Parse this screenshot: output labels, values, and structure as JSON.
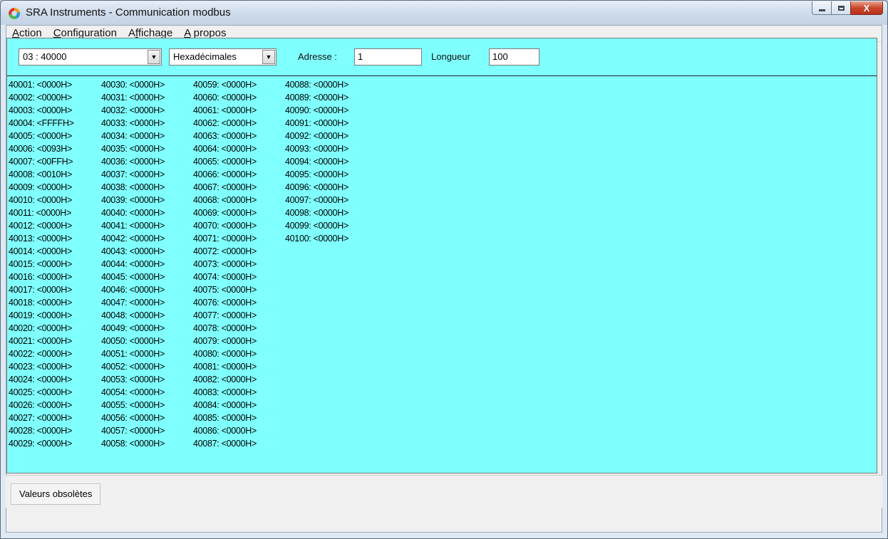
{
  "window": {
    "title": "SRA Instruments - Communication modbus",
    "close_symbol": "X"
  },
  "menu": [
    {
      "accel": "A",
      "rest": "ction"
    },
    {
      "accel": "C",
      "rest": "onfiguration"
    },
    {
      "prefix": "A",
      "accel": "f",
      "rest": "fichage"
    },
    {
      "accel": "A",
      "rest": " propos"
    }
  ],
  "toolbar": {
    "function_select": "03 : 40000",
    "format_select": "Hexadécimales",
    "address_label": "Adresse :",
    "address_value": "1",
    "length_label": "Longueur",
    "length_value": "100",
    "dropdown_arrow": "▼"
  },
  "registers": [
    "40001: <0000H>",
    "40002: <0000H>",
    "40003: <0000H>",
    "40004: <FFFFH>",
    "40005: <0000H>",
    "40006: <0093H>",
    "40007: <00FFH>",
    "40008: <0010H>",
    "40009: <0000H>",
    "40010: <0000H>",
    "40011: <0000H>",
    "40012: <0000H>",
    "40013: <0000H>",
    "40014: <0000H>",
    "40015: <0000H>",
    "40016: <0000H>",
    "40017: <0000H>",
    "40018: <0000H>",
    "40019: <0000H>",
    "40020: <0000H>",
    "40021: <0000H>",
    "40022: <0000H>",
    "40023: <0000H>",
    "40024: <0000H>",
    "40025: <0000H>",
    "40026: <0000H>",
    "40027: <0000H>",
    "40028: <0000H>",
    "40029: <0000H>",
    "40030: <0000H>",
    "40031: <0000H>",
    "40032: <0000H>",
    "40033: <0000H>",
    "40034: <0000H>",
    "40035: <0000H>",
    "40036: <0000H>",
    "40037: <0000H>",
    "40038: <0000H>",
    "40039: <0000H>",
    "40040: <0000H>",
    "40041: <0000H>",
    "40042: <0000H>",
    "40043: <0000H>",
    "40044: <0000H>",
    "40045: <0000H>",
    "40046: <0000H>",
    "40047: <0000H>",
    "40048: <0000H>",
    "40049: <0000H>",
    "40050: <0000H>",
    "40051: <0000H>",
    "40052: <0000H>",
    "40053: <0000H>",
    "40054: <0000H>",
    "40055: <0000H>",
    "40056: <0000H>",
    "40057: <0000H>",
    "40058: <0000H>",
    "40059: <0000H>",
    "40060: <0000H>",
    "40061: <0000H>",
    "40062: <0000H>",
    "40063: <0000H>",
    "40064: <0000H>",
    "40065: <0000H>",
    "40066: <0000H>",
    "40067: <0000H>",
    "40068: <0000H>",
    "40069: <0000H>",
    "40070: <0000H>",
    "40071: <0000H>",
    "40072: <0000H>",
    "40073: <0000H>",
    "40074: <0000H>",
    "40075: <0000H>",
    "40076: <0000H>",
    "40077: <0000H>",
    "40078: <0000H>",
    "40079: <0000H>",
    "40080: <0000H>",
    "40081: <0000H>",
    "40082: <0000H>",
    "40083: <0000H>",
    "40084: <0000H>",
    "40085: <0000H>",
    "40086: <0000H>",
    "40087: <0000H>",
    "40088: <0000H>",
    "40089: <0000H>",
    "40090: <0000H>",
    "40091: <0000H>",
    "40092: <0000H>",
    "40093: <0000H>",
    "40094: <0000H>",
    "40095: <0000H>",
    "40096: <0000H>",
    "40097: <0000H>",
    "40098: <0000H>",
    "40099: <0000H>",
    "40100: <0000H>"
  ],
  "status": {
    "button_label": "Valeurs obsolètes"
  },
  "colors": {
    "panel_background": "#80ffff"
  }
}
